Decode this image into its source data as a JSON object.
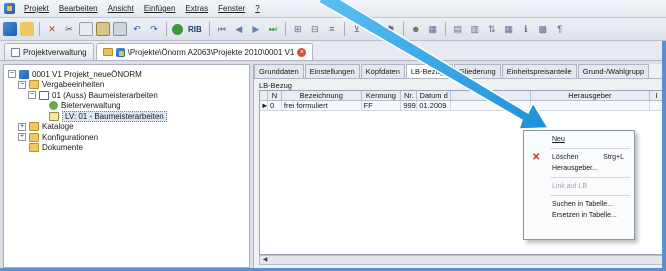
{
  "menubar": {
    "items": [
      "Projekt",
      "Bearbeiten",
      "Ansicht",
      "Einfügen",
      "Extras",
      "Fenster",
      "?"
    ]
  },
  "toolbar": {
    "rib_label": "RIB"
  },
  "doctabs": [
    {
      "label": "Projektverwaltung"
    },
    {
      "label": "\\Projekte\\Önorm A2063\\Projekte 2010\\0001 V1"
    }
  ],
  "tree": {
    "items": [
      {
        "label": "0001 V1 Projekt_neueÖNORM",
        "level": 0,
        "icon": "project-icon",
        "expander": "−"
      },
      {
        "label": "Vergabeeinheiten",
        "level": 1,
        "icon": "folder-icon",
        "expander": "−"
      },
      {
        "label": "01 (Auss) Baumeisterarbeiten",
        "level": 2,
        "icon": "document-icon",
        "expander": "−"
      },
      {
        "label": "Bieterverwaltung",
        "level": 3,
        "icon": "people-icon",
        "expander": ""
      },
      {
        "label": "LV: 01 - Baumeisterarbeiten",
        "level": 3,
        "icon": "lv-icon",
        "expander": "",
        "selected": true
      },
      {
        "label": "Kataloge",
        "level": 1,
        "icon": "folder-icon",
        "expander": "+"
      },
      {
        "label": "Konfigurationen",
        "level": 1,
        "icon": "folder-icon",
        "expander": "+"
      },
      {
        "label": "Dokumente",
        "level": 1,
        "icon": "folder-icon",
        "expander": ""
      }
    ]
  },
  "content": {
    "tabs": [
      "Grunddaten",
      "Einstellungen",
      "Kopfdaten",
      "LB-Bezüge",
      "Gliederung",
      "Einheitspreisanteile",
      "Grund-/Wahlgrupp"
    ],
    "active_tab": "LB-Bezüge",
    "section_label": "LB-Bezug",
    "grid": {
      "columns": [
        "",
        "N",
        "Bezeichnung",
        "Kennung",
        "Nr.",
        "Datum d",
        "Funk",
        "Herausgeber",
        "I"
      ],
      "rows": [
        [
          "►",
          "0",
          "frei formuliert",
          "FF",
          "999",
          "01.2009",
          "",
          "",
          ""
        ]
      ]
    }
  },
  "context_menu": {
    "items": [
      {
        "label": "Neu",
        "shortcut": "",
        "disabled": false
      },
      {
        "label": "Löschen",
        "shortcut": "Strg+L",
        "disabled": false,
        "icon": "delete-icon"
      },
      {
        "label": "Herausgeber...",
        "shortcut": "",
        "disabled": false
      },
      {
        "label": "Link auf LB",
        "shortcut": "",
        "disabled": true
      },
      {
        "label": "Suchen in Tabelle...",
        "shortcut": "",
        "disabled": false
      },
      {
        "label": "Ersetzen in Tabelle...",
        "shortcut": "",
        "disabled": false
      }
    ]
  },
  "colors": {
    "annotation_arrow": "#2fa3e6",
    "frame": "#5c8fd0",
    "delete_icon": "#d8332a"
  }
}
